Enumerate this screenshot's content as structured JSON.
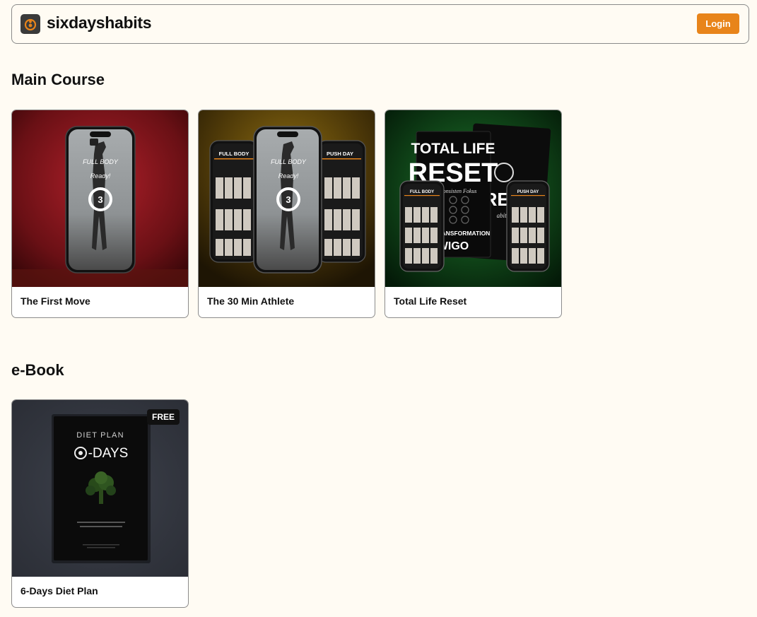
{
  "header": {
    "brand": "sixdayshabits",
    "logo_icon": "flame-logo-icon",
    "login_label": "Login",
    "accent": "#e8841a"
  },
  "sections": {
    "main_course": {
      "title": "Main Course",
      "cards": [
        {
          "title": "The First Move",
          "screen_title": "FULL BODY",
          "screen_sub": "Ready!",
          "count": "3"
        },
        {
          "title": "The 30 Min Athlete",
          "screen_title": "FULL BODY",
          "screen_sub": "Ready!",
          "count": "3",
          "left_phone": "FULL BODY",
          "right_phone": "PUSH DAY"
        },
        {
          "title": "Total Life Reset",
          "book_line1": "TOTAL LIFE",
          "book_line2": "RESET",
          "book_small": "dan Konsisten Fokus",
          "book_foot1": "SELF-TRANSFORMATION",
          "book_foot2": "WIGO",
          "back_text": "RESI",
          "back_small": "abit Tra",
          "left_phone": "FULL BODY",
          "right_phone": "PUSH DAY"
        }
      ]
    },
    "ebook": {
      "title": "e-Book",
      "cards": [
        {
          "title": "6-Days Diet Plan",
          "badge": "FREE",
          "cover_top": "DIET PLAN",
          "cover_main": "-DAYS"
        }
      ]
    }
  }
}
